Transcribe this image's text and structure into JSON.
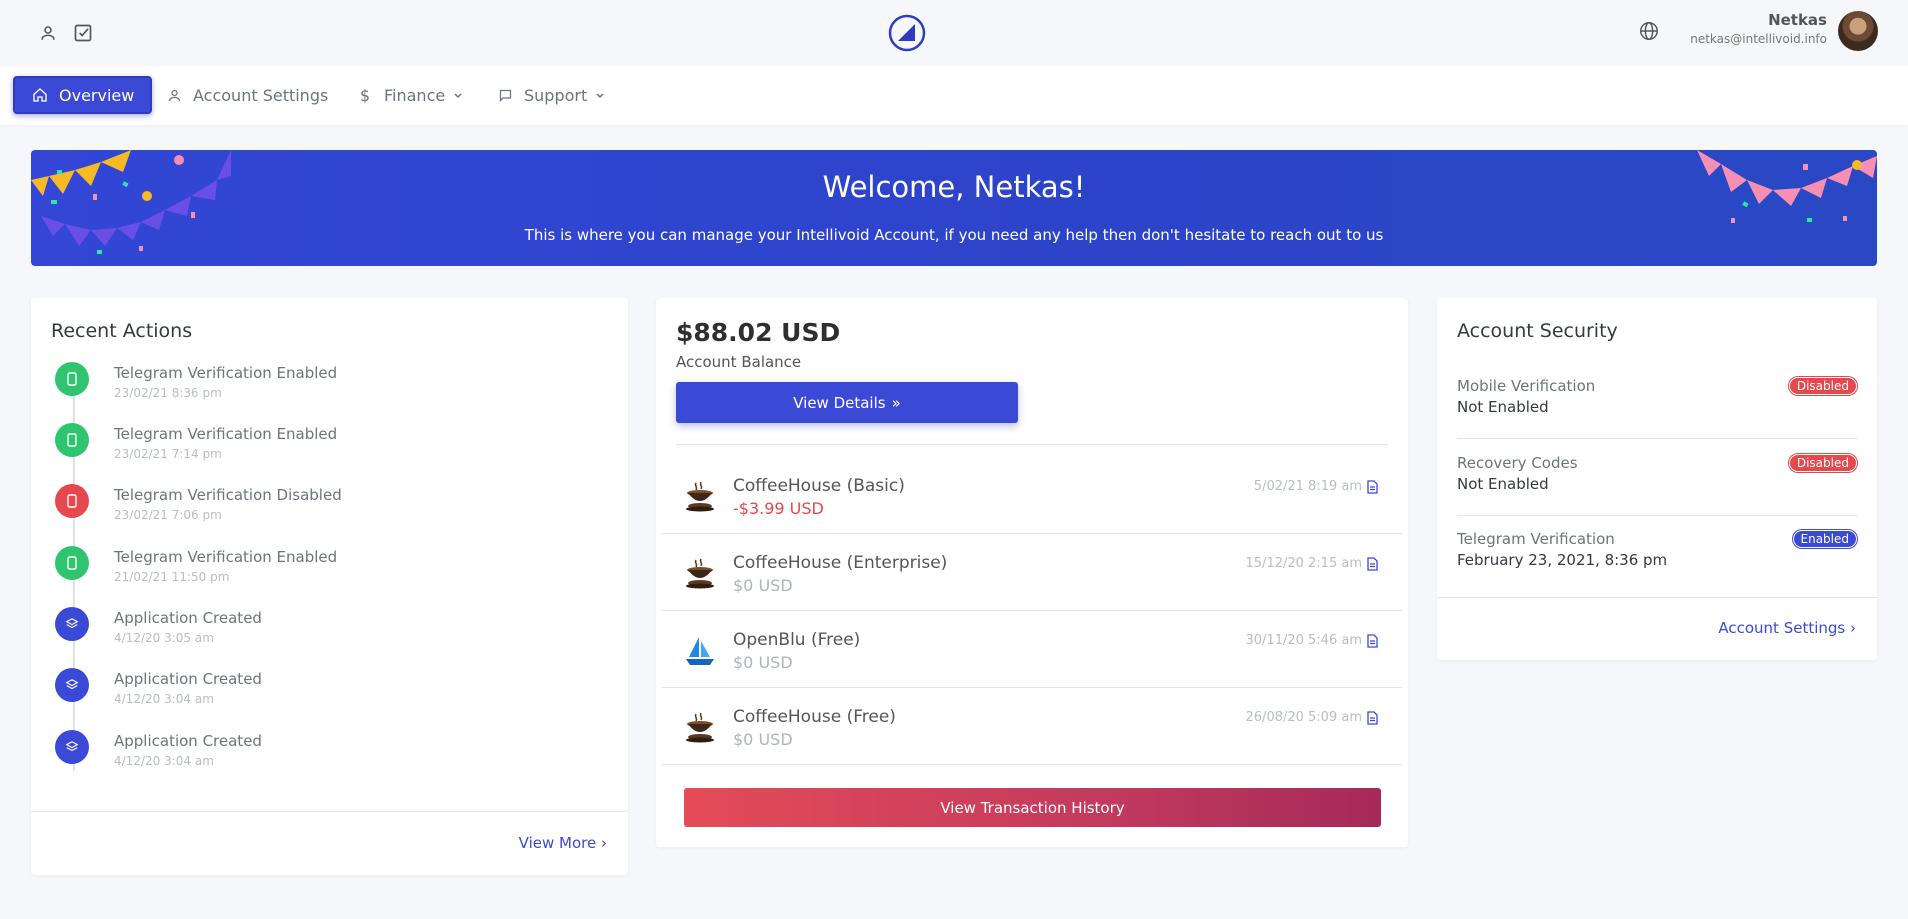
{
  "user": {
    "name": "Netkas",
    "email": "netkas@intellivoid.info"
  },
  "nav": {
    "overview": "Overview",
    "account_settings": "Account Settings",
    "finance": "Finance",
    "support": "Support"
  },
  "banner": {
    "title": "Welcome, Netkas!",
    "subtitle": "This is where you can manage your Intellivoid Account, if you need any help then don't hesitate to reach out to us"
  },
  "recent_actions": {
    "title": "Recent Actions",
    "items": [
      {
        "title": "Telegram Verification Enabled",
        "time": "23/02/21 8:36 pm",
        "color": "#2fc56f",
        "icon": "phone-icon"
      },
      {
        "title": "Telegram Verification Enabled",
        "time": "23/02/21 7:14 pm",
        "color": "#2fc56f",
        "icon": "phone-icon"
      },
      {
        "title": "Telegram Verification Disabled",
        "time": "23/02/21 7:06 pm",
        "color": "#e5484d",
        "icon": "phone-icon"
      },
      {
        "title": "Telegram Verification Enabled",
        "time": "21/02/21 11:50 pm",
        "color": "#2fc56f",
        "icon": "phone-icon"
      },
      {
        "title": "Application Created",
        "time": "4/12/20 3:05 am",
        "color": "#3b4ad6",
        "icon": "layers-icon"
      },
      {
        "title": "Application Created",
        "time": "4/12/20 3:04 am",
        "color": "#3b4ad6",
        "icon": "layers-icon"
      },
      {
        "title": "Application Created",
        "time": "4/12/20 3:04 am",
        "color": "#3b4ad6",
        "icon": "layers-icon"
      }
    ],
    "view_more": "View More"
  },
  "balance": {
    "amount": "$88.02 USD",
    "label": "Account Balance",
    "view_details": "View Details",
    "transactions": [
      {
        "name": "CoffeeHouse (Basic)",
        "amount": "-$3.99 USD",
        "date": "5/02/21 8:19 am",
        "icon": "coffee-icon"
      },
      {
        "name": "CoffeeHouse (Enterprise)",
        "amount": "$0 USD",
        "date": "15/12/20 2:15 am",
        "icon": "coffee-icon"
      },
      {
        "name": "OpenBlu (Free)",
        "amount": "$0 USD",
        "date": "30/11/20 5:46 am",
        "icon": "sailboat-icon"
      },
      {
        "name": "CoffeeHouse (Free)",
        "amount": "$0 USD",
        "date": "26/08/20 5:09 am",
        "icon": "coffee-icon"
      }
    ],
    "view_history": "View Transaction History"
  },
  "security": {
    "title": "Account Security",
    "items": [
      {
        "label": "Mobile Verification",
        "value": "Not Enabled",
        "badge": "Disabled",
        "badge_color": "#e5484d"
      },
      {
        "label": "Recovery Codes",
        "value": "Not Enabled",
        "badge": "Disabled",
        "badge_color": "#e5484d"
      },
      {
        "label": "Telegram Verification",
        "value": "February 23, 2021, 8:36 pm",
        "badge": "Enabled",
        "badge_color": "#3b4ad6"
      }
    ],
    "account_settings_link": "Account Settings"
  },
  "colors": {
    "primary": "#3b4ad6",
    "success": "#2fc56f",
    "danger": "#e5484d"
  }
}
